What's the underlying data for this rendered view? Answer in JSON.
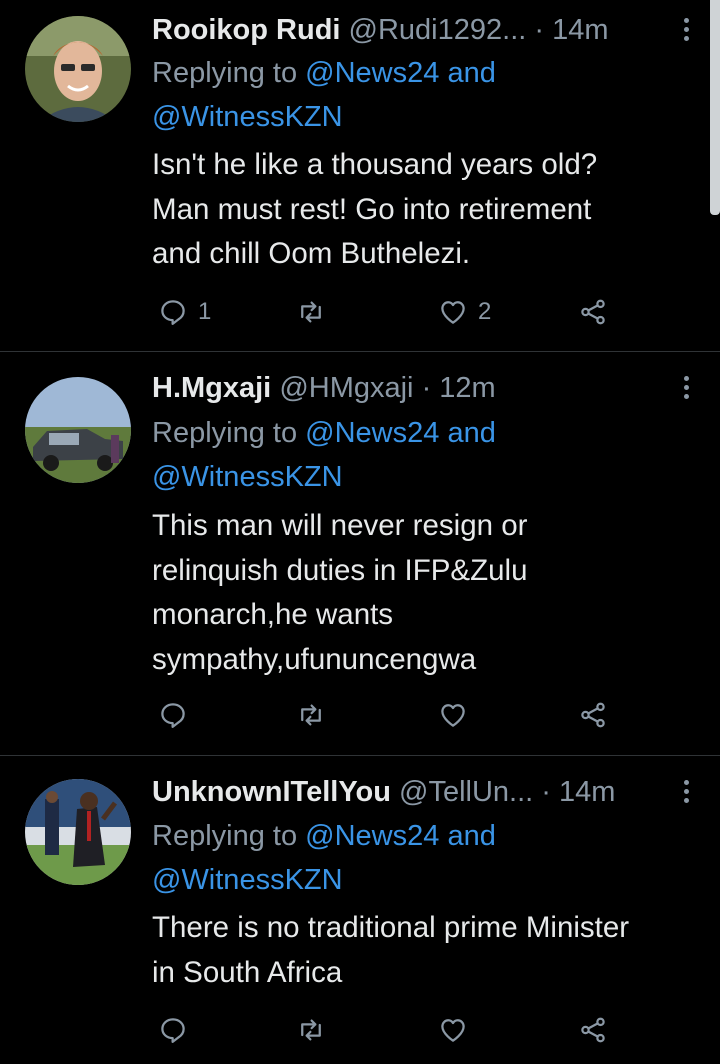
{
  "tweets": [
    {
      "name": "Rooikop Rudi",
      "handle": "@Rudi1292...",
      "sep": "·",
      "time": "14m",
      "replying_prefix": "Replying to",
      "replying_1": "@News24",
      "replying_and": "and",
      "replying_2": "@WitnessKZN",
      "lines": [
        "Isn't he like a thousand years old?",
        "Man must rest! Go into retirement",
        "and chill Oom Buthelezi."
      ],
      "reply_count": "1",
      "retweet_count": "",
      "like_count": "2"
    },
    {
      "name": "H.Mgxaji",
      "handle": "@HMgxaji",
      "sep": "·",
      "time": "12m",
      "replying_prefix": "Replying to",
      "replying_1": "@News24",
      "replying_and": "and",
      "replying_2": "@WitnessKZN",
      "lines": [
        "This man will never resign or",
        "relinquish duties in IFP&Zulu",
        "monarch,he wants",
        "sympathy,ufununcengwa"
      ],
      "reply_count": "",
      "retweet_count": "",
      "like_count": ""
    },
    {
      "name": "UnknownITellYou",
      "handle": "@TellUn...",
      "sep": "·",
      "time": "14m",
      "replying_prefix": "Replying to",
      "replying_1": "@News24",
      "replying_and": "and",
      "replying_2": "@WitnessKZN",
      "lines": [
        "There is no traditional prime Minister",
        "in South Africa"
      ],
      "reply_count": "",
      "retweet_count": "",
      "like_count": ""
    }
  ],
  "icons": {
    "reply": "reply-icon",
    "retweet": "retweet-icon",
    "like": "like-icon",
    "share": "share-icon",
    "more": "more-options-icon"
  },
  "colors": {
    "background": "#000000",
    "text": "#e7e9ea",
    "secondary": "#8b98a5",
    "mention": "#3a94e6",
    "divider": "#2f3336"
  }
}
